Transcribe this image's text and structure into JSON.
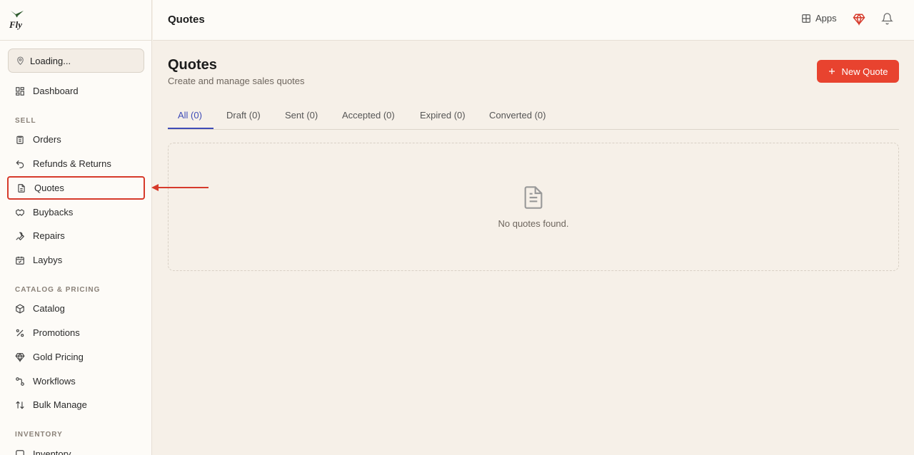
{
  "app": {
    "logo_text": "Fly"
  },
  "sidebar": {
    "location": "Loading...",
    "dashboard": "Dashboard",
    "sections": {
      "sell": "SELL",
      "catalog": "CATALOG & PRICING",
      "inventory": "INVENTORY"
    },
    "sell_items": [
      "Orders",
      "Refunds & Returns",
      "Quotes",
      "Buybacks",
      "Repairs",
      "Laybys"
    ],
    "catalog_items": [
      "Catalog",
      "Promotions",
      "Gold Pricing",
      "Workflows",
      "Bulk Manage"
    ],
    "inventory_items": [
      "Inventory"
    ]
  },
  "header": {
    "title": "Quotes",
    "apps_label": "Apps"
  },
  "main": {
    "title": "Quotes",
    "subtitle": "Create and manage sales quotes",
    "new_button": "New Quote",
    "tabs": [
      "All (0)",
      "Draft (0)",
      "Sent (0)",
      "Accepted (0)",
      "Expired (0)",
      "Converted (0)"
    ],
    "empty_text": "No quotes found."
  },
  "colors": {
    "accent": "#e8432f",
    "tab_active": "#3f4cb7",
    "highlight": "#d63a2b"
  }
}
